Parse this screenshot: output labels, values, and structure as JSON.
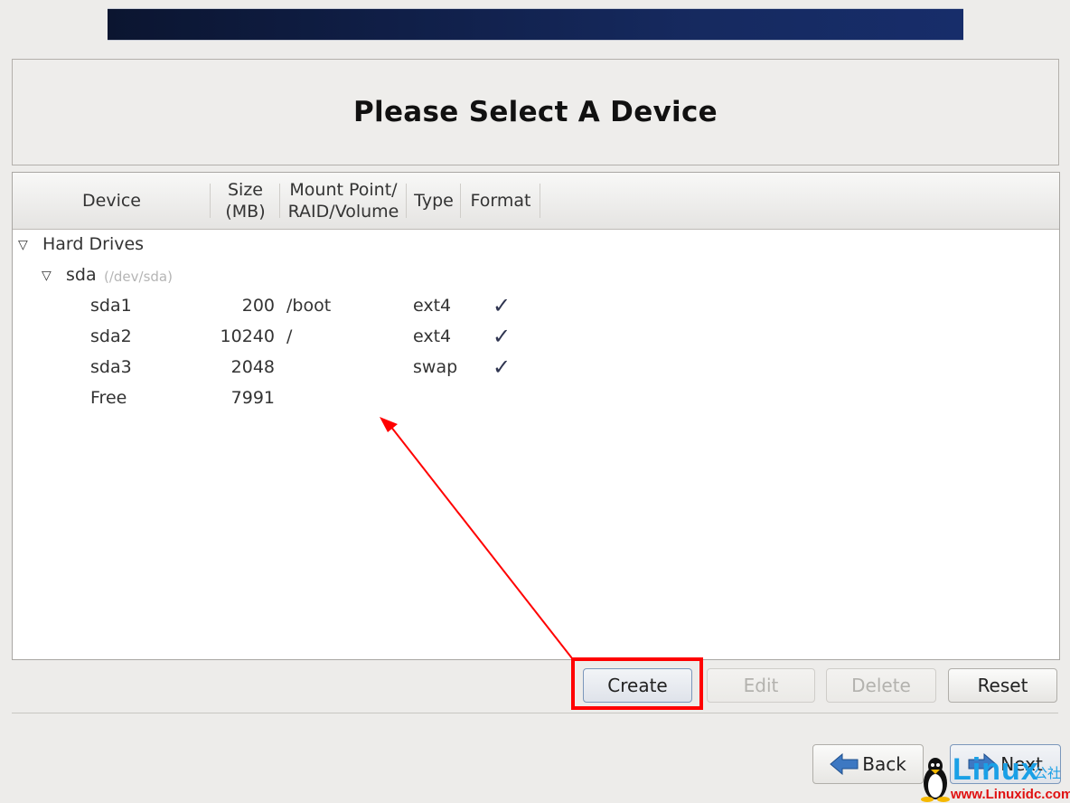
{
  "page": {
    "title": "Please Select A Device"
  },
  "table": {
    "headers": {
      "device": "Device",
      "size_line1": "Size",
      "size_line2": "(MB)",
      "mount_line1": "Mount Point/",
      "mount_line2": "RAID/Volume",
      "type": "Type",
      "format": "Format"
    },
    "groups": {
      "hard_drives": "Hard Drives",
      "disk_name": "sda",
      "disk_path": "(/dev/sda)"
    },
    "rows": [
      {
        "device": "sda1",
        "size": "200",
        "mount": "/boot",
        "type": "ext4",
        "format": "✓"
      },
      {
        "device": "sda2",
        "size": "10240",
        "mount": "/",
        "type": "ext4",
        "format": "✓"
      },
      {
        "device": "sda3",
        "size": "2048",
        "mount": "",
        "type": "swap",
        "format": "✓"
      },
      {
        "device": "Free",
        "size": "7991",
        "mount": "",
        "type": "",
        "format": ""
      }
    ],
    "expander_glyph": "▽"
  },
  "actions": {
    "create": "Create",
    "edit": "Edit",
    "delete": "Delete",
    "reset": "Reset"
  },
  "nav": {
    "back": "Back",
    "next": "Next"
  },
  "annotation": {
    "color": "#ff0000",
    "target": "Create"
  },
  "watermark": {
    "brand": "Linux",
    "brand_cn": "公社",
    "url": "www.Linuxidc.com"
  }
}
